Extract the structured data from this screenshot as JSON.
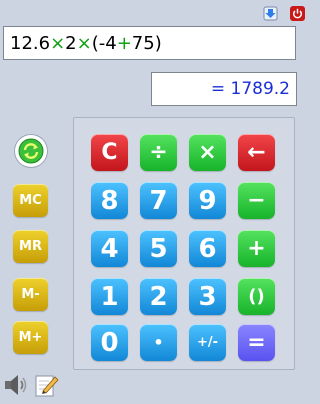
{
  "expression": {
    "parts": [
      "12.6",
      "×",
      "2",
      "×",
      "(-4",
      "+",
      "75)"
    ]
  },
  "result": "= 1789.2",
  "keypad": {
    "row1": [
      "C",
      "÷",
      "×",
      "←"
    ],
    "row2": [
      "8",
      "7",
      "9",
      "−"
    ],
    "row3": [
      "4",
      "5",
      "6",
      "+"
    ],
    "row4": [
      "1",
      "2",
      "3",
      "()"
    ],
    "row5": [
      "0",
      "•",
      "+/-",
      "="
    ]
  },
  "memory": [
    "MC",
    "MR",
    "M-",
    "M+"
  ],
  "icons": {
    "minimize": "down-arrow-icon",
    "close": "power-icon",
    "refresh": "refresh-icon",
    "speaker": "speaker-icon",
    "edit": "pencil-icon"
  },
  "colors": {
    "red": "#d9262c",
    "green": "#2dc23c",
    "blue": "#22a0ea",
    "purple": "#6c66f6",
    "gold": "#dab81a",
    "result_text": "#1a2fd6",
    "operator_green": "#10a010"
  }
}
